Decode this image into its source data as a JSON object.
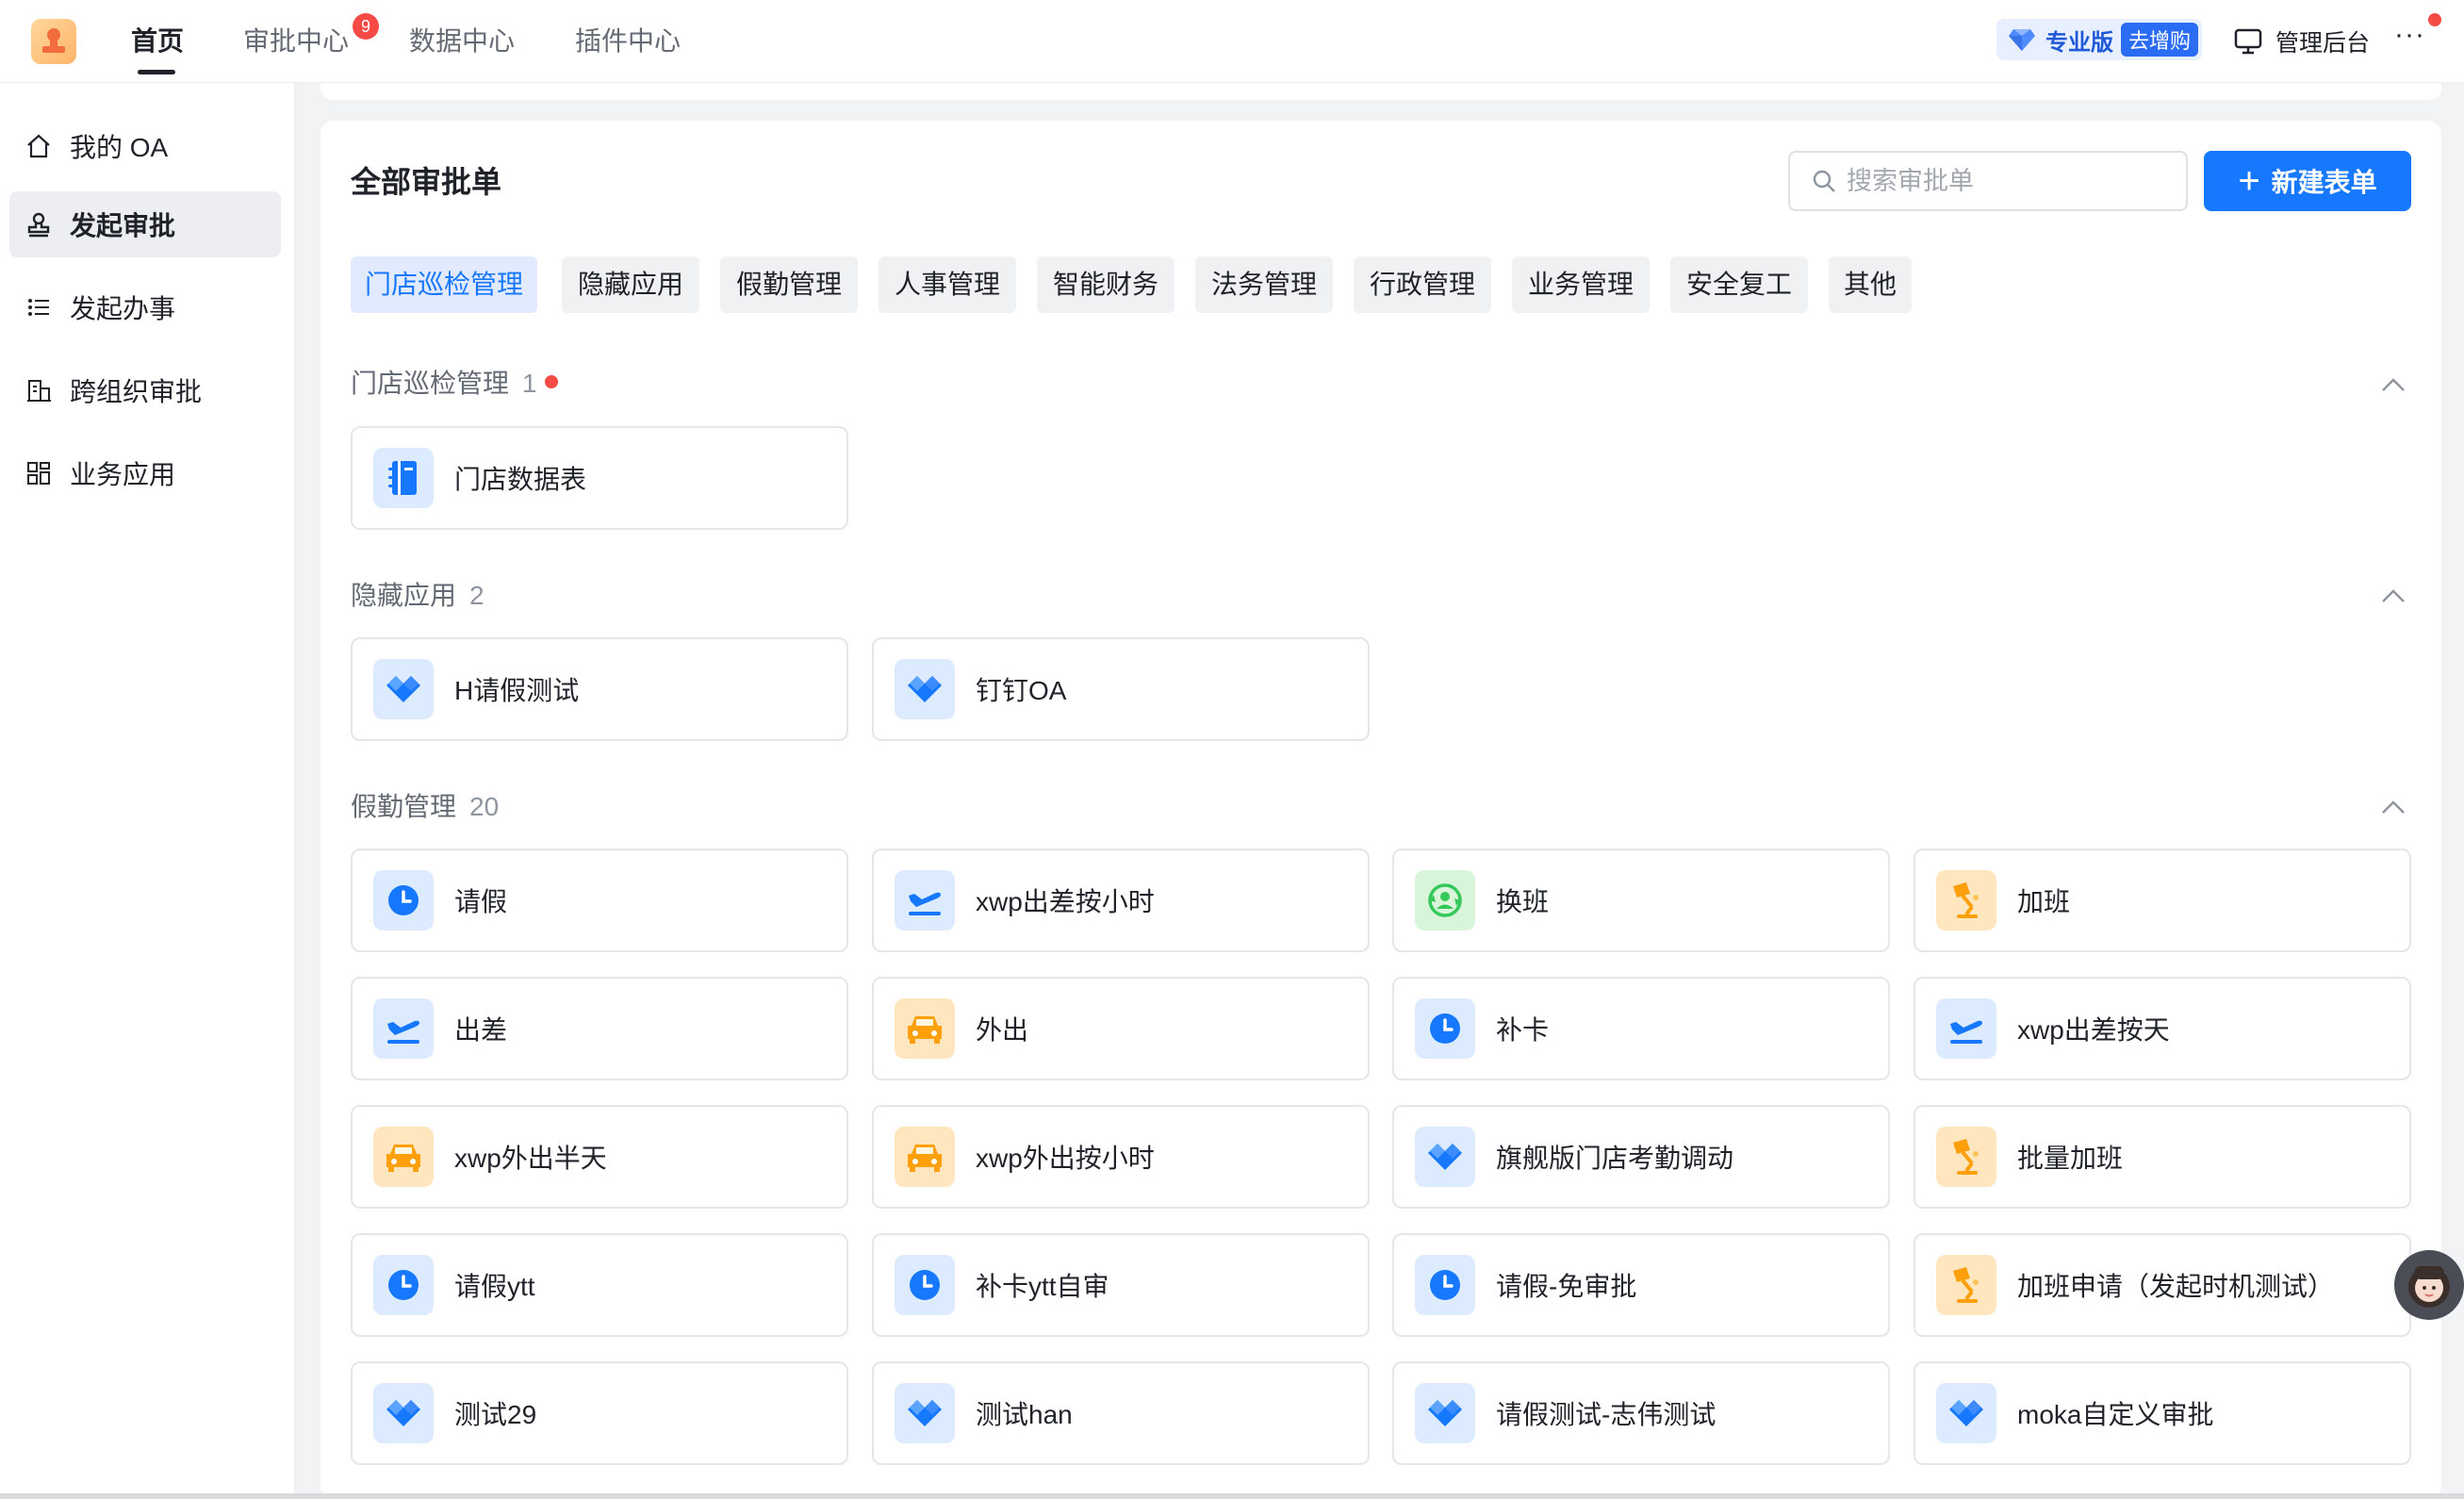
{
  "topnav": {
    "tabs": [
      {
        "label": "首页",
        "active": true
      },
      {
        "label": "审批中心",
        "badge": "9"
      },
      {
        "label": "数据中心"
      },
      {
        "label": "插件中心"
      }
    ],
    "pro_label": "专业版",
    "pro_buy": "去增购",
    "admin_label": "管理后台",
    "more_label": "···"
  },
  "sidebar": {
    "items": [
      {
        "label": "我的 OA",
        "icon": "home-icon"
      },
      {
        "label": "发起审批",
        "icon": "stamp-icon",
        "active": true
      },
      {
        "label": "发起办事",
        "icon": "list-icon"
      },
      {
        "label": "跨组织审批",
        "icon": "building-icon"
      },
      {
        "label": "业务应用",
        "icon": "grid-icon"
      }
    ]
  },
  "main": {
    "title": "全部审批单",
    "search_placeholder": "搜索审批单",
    "new_button": "新建表单",
    "categories": [
      "门店巡检管理",
      "隐藏应用",
      "假勤管理",
      "人事管理",
      "智能财务",
      "法务管理",
      "行政管理",
      "业务管理",
      "安全复工",
      "其他"
    ],
    "sections": [
      {
        "name": "门店巡检管理",
        "count": "1",
        "dot": true,
        "apps": [
          {
            "name": "门店数据表",
            "icon": "notebook-icon",
            "bg": "#dcebff"
          }
        ]
      },
      {
        "name": "隐藏应用",
        "count": "2",
        "apps": [
          {
            "name": "H请假测试",
            "icon": "diamond-icon",
            "bg": "#dcebff"
          },
          {
            "name": "钉钉OA",
            "icon": "diamond-icon",
            "bg": "#dcebff"
          }
        ]
      },
      {
        "name": "假勤管理",
        "count": "20",
        "apps": [
          {
            "name": "请假",
            "icon": "clock-icon",
            "bg": "#dcebff"
          },
          {
            "name": "xwp出差按小时",
            "icon": "plane-icon",
            "bg": "#dcebff"
          },
          {
            "name": "换班",
            "icon": "swap-user-icon",
            "bg": "#d9f5d9"
          },
          {
            "name": "加班",
            "icon": "lamp-icon",
            "bg": "#ffe6bf"
          },
          {
            "name": "出差",
            "icon": "plane-icon",
            "bg": "#dcebff"
          },
          {
            "name": "外出",
            "icon": "car-icon",
            "bg": "#ffe6bf"
          },
          {
            "name": "补卡",
            "icon": "clock-icon",
            "bg": "#dcebff"
          },
          {
            "name": "xwp出差按天",
            "icon": "plane-icon",
            "bg": "#dcebff"
          },
          {
            "name": "xwp外出半天",
            "icon": "car-icon",
            "bg": "#ffe6bf"
          },
          {
            "name": "xwp外出按小时",
            "icon": "car-icon",
            "bg": "#ffe6bf"
          },
          {
            "name": "旗舰版门店考勤调动",
            "icon": "diamond-icon",
            "bg": "#dcebff"
          },
          {
            "name": "批量加班",
            "icon": "lamp-icon",
            "bg": "#ffe6bf"
          },
          {
            "name": "请假ytt",
            "icon": "clock-icon",
            "bg": "#dcebff"
          },
          {
            "name": "补卡ytt自审",
            "icon": "clock-icon",
            "bg": "#dcebff"
          },
          {
            "name": "请假-免审批",
            "icon": "clock-icon",
            "bg": "#dcebff"
          },
          {
            "name": "加班申请（发起时机测试）",
            "icon": "lamp-icon",
            "bg": "#ffe6bf"
          },
          {
            "name": "测试29",
            "icon": "diamond-icon",
            "bg": "#dcebff"
          },
          {
            "name": "测试han",
            "icon": "diamond-icon",
            "bg": "#dcebff"
          },
          {
            "name": "请假测试-志伟测试",
            "icon": "diamond-icon",
            "bg": "#dcebff"
          },
          {
            "name": "moka自定义审批",
            "icon": "diamond-icon",
            "bg": "#dcebff"
          }
        ]
      }
    ]
  }
}
